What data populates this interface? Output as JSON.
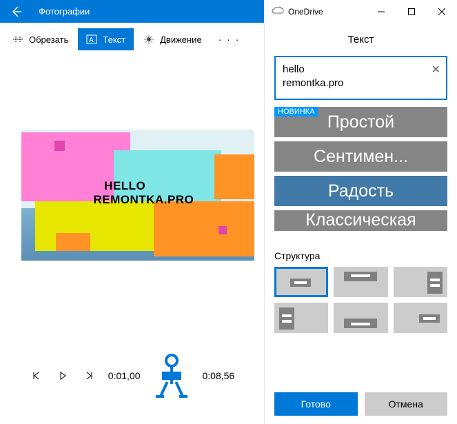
{
  "left": {
    "title": "Фотографии",
    "tools": {
      "crop": "Обрезать",
      "text": "Текст",
      "motion": "Движение"
    },
    "canvas_text": "   HELLO\nREMONTKA.PRO",
    "time_current": "0:01,00",
    "time_total": "0:08,56"
  },
  "right": {
    "app": "OneDrive",
    "panel_title": "Текст",
    "input_value": "hello\nremontka.pro",
    "badge": "НОВИНКА",
    "styles": [
      "Простой",
      "Сентимен...",
      "Радость",
      "Классическая"
    ],
    "selected_style_index": 2,
    "section_layout": "Структура",
    "selected_layout_index": 0,
    "buttons": {
      "done": "Готово",
      "cancel": "Отмена"
    }
  }
}
